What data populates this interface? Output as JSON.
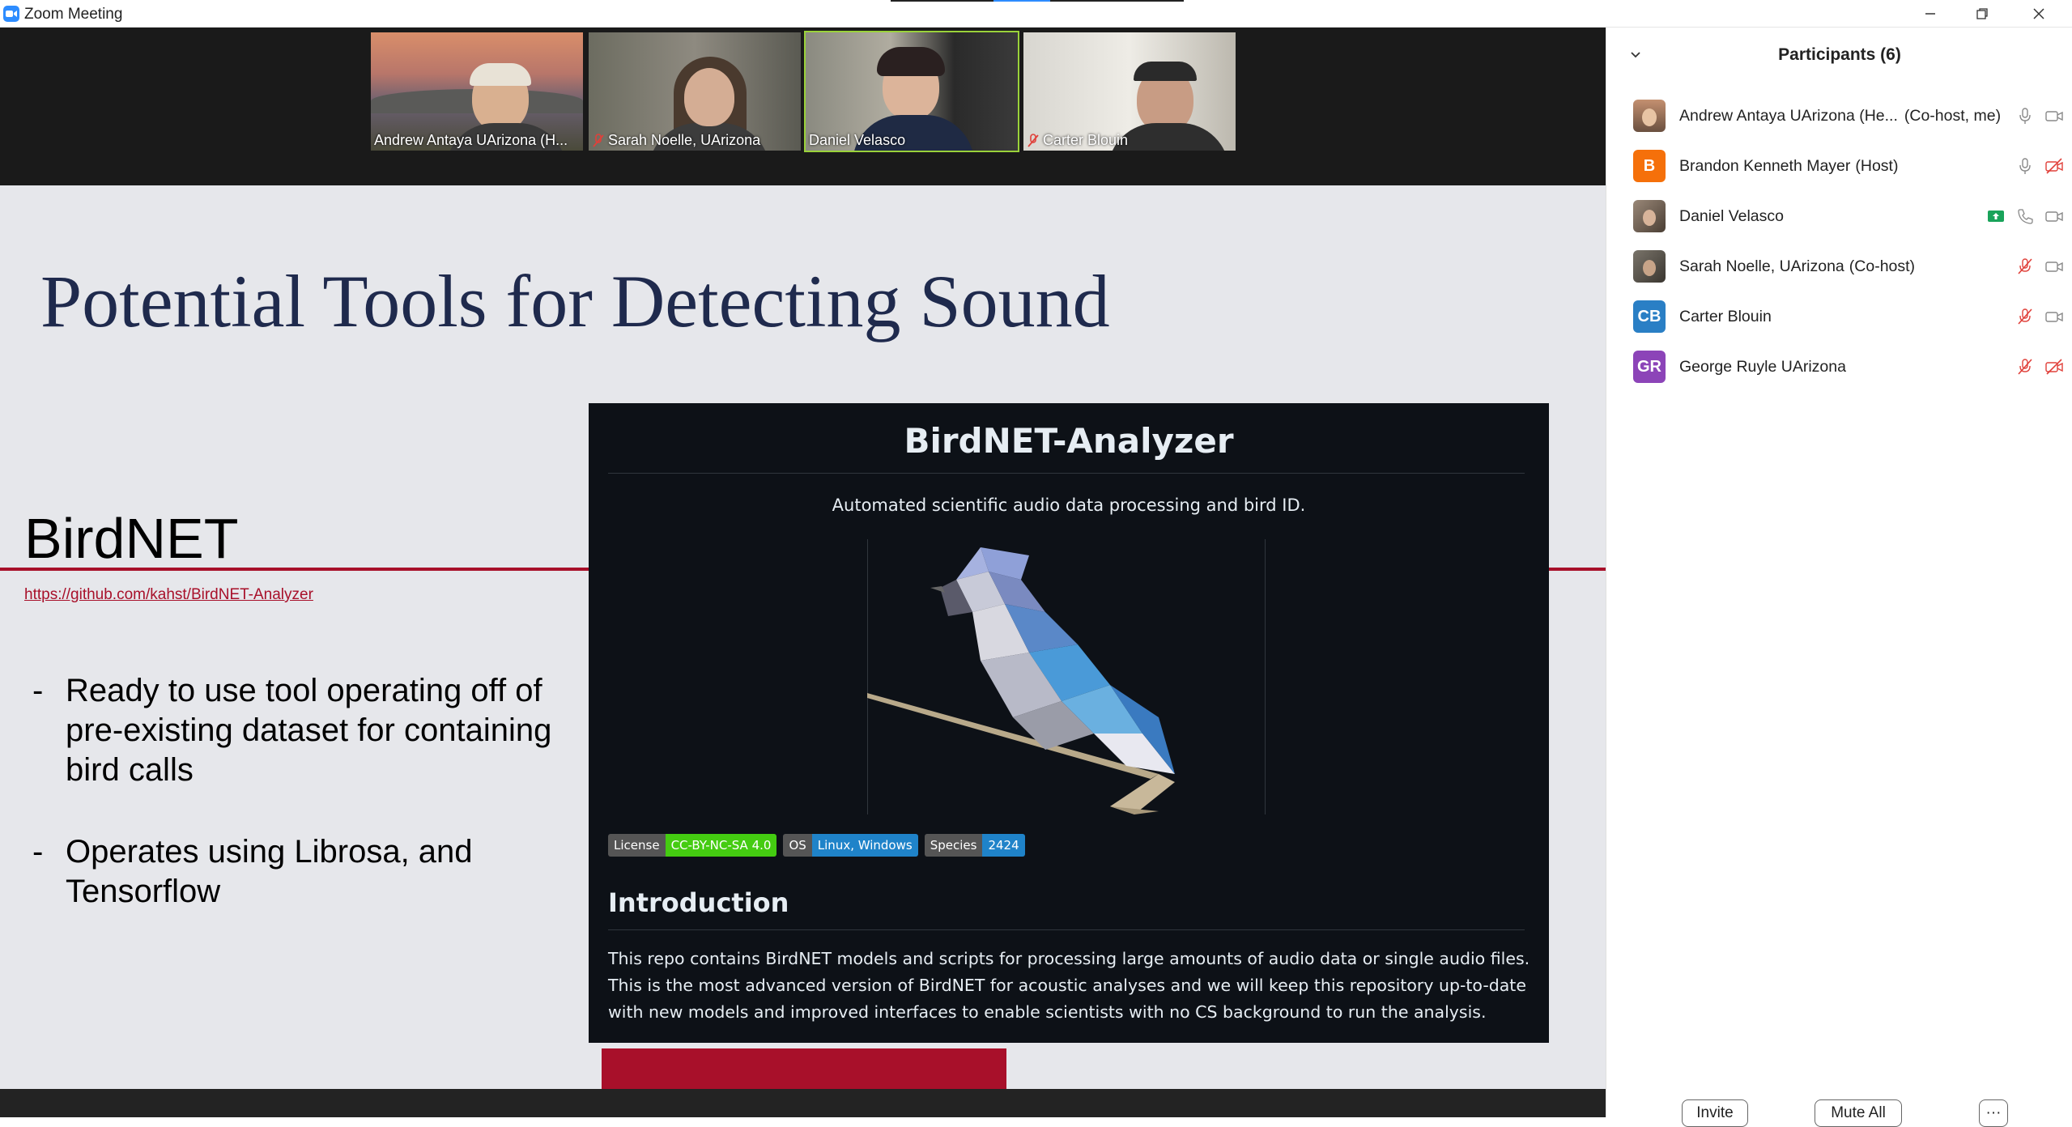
{
  "window": {
    "title": "Zoom Meeting",
    "controls": [
      "minimize-icon",
      "restore-icon",
      "close-icon"
    ]
  },
  "video_strip": {
    "tiles": [
      {
        "name": "Andrew Antaya UArizona (H...",
        "muted": false,
        "active": false
      },
      {
        "name": "Sarah Noelle, UArizona",
        "muted": true,
        "active": false
      },
      {
        "name": "Daniel Velasco",
        "muted": false,
        "active": true
      },
      {
        "name": "Carter Blouin",
        "muted": true,
        "active": false
      }
    ]
  },
  "slide": {
    "title": "Potential Tools for Detecting Sound",
    "section_title": "BirdNET",
    "link": "https://github.com/kahst/BirdNET-Analyzer",
    "bullets": [
      "Ready to use tool operating off of pre-existing dataset for containing bird calls",
      "Operates using Librosa, and Tensorflow"
    ],
    "bullet_marker": "-",
    "repo": {
      "title": "BirdNET-Analyzer",
      "subtitle": "Automated scientific audio data processing and bird ID.",
      "badges": [
        {
          "key": "License",
          "value": "CC-BY-NC-SA 4.0",
          "color": "#44cc11"
        },
        {
          "key": "OS",
          "value": "Linux, Windows",
          "color": "#1f83c9"
        },
        {
          "key": "Species",
          "value": "2424",
          "color": "#1f83c9"
        }
      ],
      "heading": "Introduction",
      "paragraph": "This repo contains BirdNET models and scripts for processing large amounts of audio data or single audio files. This is the most advanced version of BirdNET for acoustic analyses and we will keep this repository up-to-date with new models and improved interfaces to enable scientists with no CS background to run the analysis."
    }
  },
  "participants": {
    "title": "Participants (6)",
    "list": [
      {
        "name": "Andrew Antaya UArizona (He...",
        "role": "(Co-host, me)",
        "avatar": "photo",
        "avatar_color": "#a0785a",
        "mic": "on",
        "video": "on"
      },
      {
        "name": "Brandon Kenneth Mayer",
        "role": "(Host)",
        "avatar": "B",
        "avatar_color": "#f5700a",
        "mic": "on",
        "video": "off"
      },
      {
        "name": "Daniel Velasco",
        "role": "",
        "avatar": "photo",
        "avatar_color": "#7c6a58",
        "mic": "phone",
        "video": "on",
        "sharing": true
      },
      {
        "name": "Sarah Noelle, UArizona",
        "role": "(Co-host)",
        "avatar": "photo",
        "avatar_color": "#5a5650",
        "mic": "muted",
        "video": "on"
      },
      {
        "name": "Carter Blouin",
        "role": "",
        "avatar": "CB",
        "avatar_color": "#2a7fc5",
        "mic": "muted",
        "video": "on"
      },
      {
        "name": "George Ruyle UArizona",
        "role": "",
        "avatar": "GR",
        "avatar_color": "#8c44b8",
        "mic": "muted",
        "video": "off"
      }
    ],
    "buttons": {
      "invite": "Invite",
      "mute_all": "Mute All",
      "more": "···"
    }
  }
}
